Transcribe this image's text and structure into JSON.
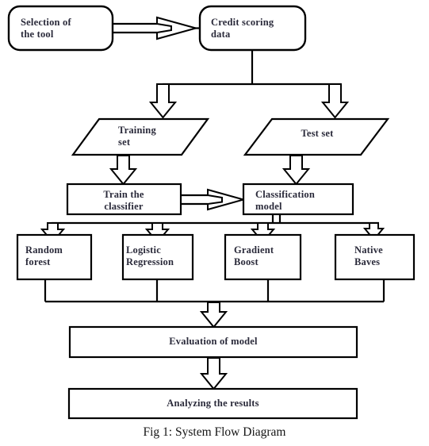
{
  "figure": {
    "caption": "Fig 1: System Flow Diagram",
    "colors": {
      "stroke": "#000000",
      "fill": "#ffffff",
      "text": "#2a2a3a",
      "caption_text": "#141414"
    }
  },
  "nodes": {
    "selection_of_tool": {
      "label": "Selection of\nthe tool",
      "shape": "rounded-rectangle"
    },
    "credit_scoring_data": {
      "label": "Credit scoring\ndata",
      "shape": "rounded-rectangle"
    },
    "training_set": {
      "label": "Training\nset",
      "shape": "parallelogram"
    },
    "test_set": {
      "label": "Test set",
      "shape": "parallelogram"
    },
    "train_the_classifier": {
      "label": "Train the\nclassifier",
      "shape": "rectangle"
    },
    "classification_model": {
      "label": "Classification\nmodel",
      "shape": "rectangle"
    },
    "random_forest": {
      "label": "Random\nforest",
      "shape": "rectangle"
    },
    "logistic_regression": {
      "label": "Logistic\nRegression",
      "shape": "rectangle"
    },
    "gradient_boost": {
      "label": "Gradient\nBoost",
      "shape": "rectangle"
    },
    "native_baves": {
      "label": "Native\nBaves",
      "shape": "rectangle"
    },
    "evaluation_of_model": {
      "label": "Evaluation of model",
      "shape": "rectangle"
    },
    "analyzing_the_results": {
      "label": "Analyzing the results",
      "shape": "rectangle"
    }
  },
  "chart_data": {
    "type": "diagram",
    "title": "Fig 1: System Flow Diagram",
    "nodes": [
      {
        "id": "selection_of_tool",
        "label": "Selection of the tool",
        "shape": "rounded-rectangle",
        "row": 1
      },
      {
        "id": "credit_scoring_data",
        "label": "Credit scoring data",
        "shape": "rounded-rectangle",
        "row": 1
      },
      {
        "id": "training_set",
        "label": "Training set",
        "shape": "parallelogram",
        "row": 2
      },
      {
        "id": "test_set",
        "label": "Test set",
        "shape": "parallelogram",
        "row": 2
      },
      {
        "id": "train_the_classifier",
        "label": "Train the classifier",
        "shape": "rectangle",
        "row": 3
      },
      {
        "id": "classification_model",
        "label": "Classification model",
        "shape": "rectangle",
        "row": 3
      },
      {
        "id": "random_forest",
        "label": "Random forest",
        "shape": "rectangle",
        "row": 4
      },
      {
        "id": "logistic_regression",
        "label": "Logistic Regression",
        "shape": "rectangle",
        "row": 4
      },
      {
        "id": "gradient_boost",
        "label": "Gradient Boost",
        "shape": "rectangle",
        "row": 4
      },
      {
        "id": "native_baves",
        "label": "Native Baves",
        "shape": "rectangle",
        "row": 4
      },
      {
        "id": "evaluation_of_model",
        "label": "Evaluation of model",
        "shape": "rectangle",
        "row": 5
      },
      {
        "id": "analyzing_the_results",
        "label": "Analyzing the results",
        "shape": "rectangle",
        "row": 6
      }
    ],
    "edges": [
      {
        "from": "selection_of_tool",
        "to": "credit_scoring_data",
        "direction": "right"
      },
      {
        "from": "credit_scoring_data",
        "to": "training_set",
        "direction": "down"
      },
      {
        "from": "credit_scoring_data",
        "to": "test_set",
        "direction": "down"
      },
      {
        "from": "training_set",
        "to": "train_the_classifier",
        "direction": "down"
      },
      {
        "from": "test_set",
        "to": "classification_model",
        "direction": "down"
      },
      {
        "from": "train_the_classifier",
        "to": "classification_model",
        "direction": "right"
      },
      {
        "from": "classification_model",
        "to": "random_forest",
        "direction": "down"
      },
      {
        "from": "classification_model",
        "to": "logistic_regression",
        "direction": "down"
      },
      {
        "from": "classification_model",
        "to": "gradient_boost",
        "direction": "down"
      },
      {
        "from": "classification_model",
        "to": "native_baves",
        "direction": "down"
      },
      {
        "from": "random_forest",
        "to": "evaluation_of_model",
        "direction": "down"
      },
      {
        "from": "logistic_regression",
        "to": "evaluation_of_model",
        "direction": "down"
      },
      {
        "from": "gradient_boost",
        "to": "evaluation_of_model",
        "direction": "down"
      },
      {
        "from": "native_baves",
        "to": "evaluation_of_model",
        "direction": "down"
      },
      {
        "from": "evaluation_of_model",
        "to": "analyzing_the_results",
        "direction": "down"
      }
    ]
  }
}
